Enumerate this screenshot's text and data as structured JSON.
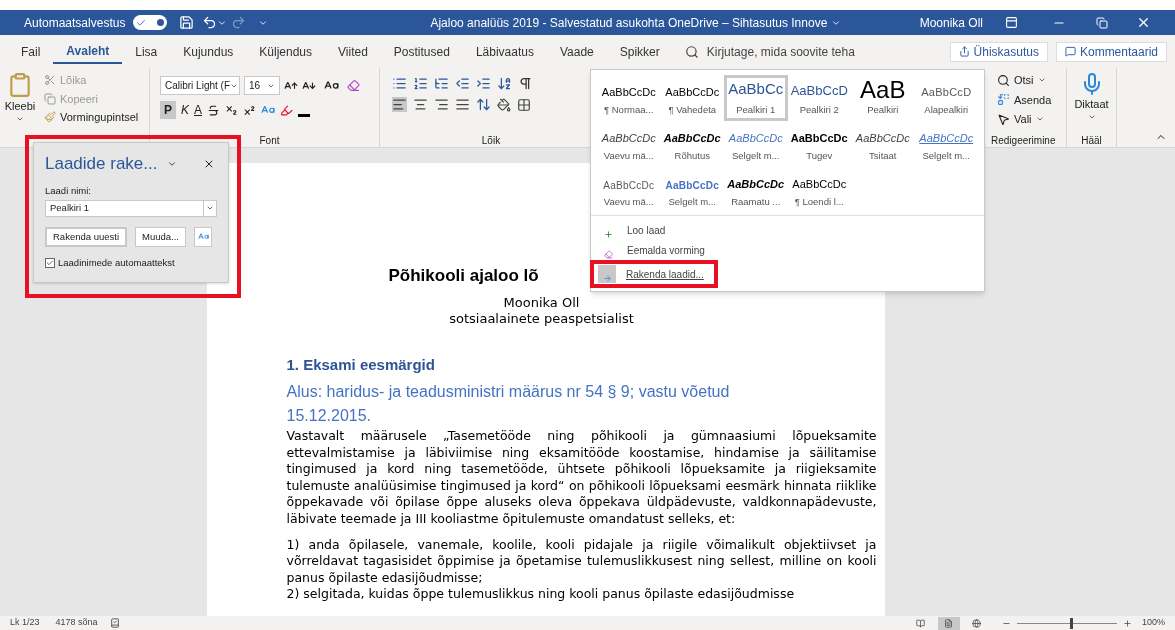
{
  "title_bar": {
    "autosave_label": "Automaatsalvestus",
    "autosave_on": true,
    "title": "Ajaloo analüüs 2019  -  Salvestatud asukohta OneDrive – Sihtasutus Innove",
    "user": "Moonika Oll"
  },
  "tabs": [
    {
      "label": "Fail",
      "selected": false
    },
    {
      "label": "Avaleht",
      "selected": true
    },
    {
      "label": "Lisa",
      "selected": false
    },
    {
      "label": "Kujundus",
      "selected": false
    },
    {
      "label": "Küljendus",
      "selected": false
    },
    {
      "label": "Viited",
      "selected": false
    },
    {
      "label": "Postitused",
      "selected": false
    },
    {
      "label": "Läbivaatus",
      "selected": false
    },
    {
      "label": "Vaade",
      "selected": false
    },
    {
      "label": "Spikker",
      "selected": false
    }
  ],
  "search": {
    "placeholder": "Kirjutage, mida soovite teha"
  },
  "share_button": "Ühiskasutus",
  "comments_button": "Kommentaarid",
  "clipboard": {
    "paste": "Kleebi",
    "cut": "Lõika",
    "copy": "Kopeeri",
    "format_painter": "Vormingupintsel"
  },
  "font": {
    "font_name": "Calibri Light (F",
    "size": "16",
    "bold": "P",
    "italic": "K",
    "underline": "A",
    "group_label": "Font"
  },
  "paragraph": {
    "group_label": "Lõik"
  },
  "editing": {
    "find": "Otsi",
    "replace": "Asenda",
    "select": "Vali",
    "group_label": "Redigeerimine"
  },
  "voice": {
    "dictate": "Diktaat",
    "group_label": "Hääl"
  },
  "styles_gallery": {
    "styles": [
      {
        "preview": "AaBbCcDc",
        "label": "¶ Normaa...",
        "kind": "normal",
        "selected": false
      },
      {
        "preview": "AaBbCcDc",
        "label": "¶ Vahedeta",
        "kind": "normal",
        "selected": false
      },
      {
        "preview": "AaBbCc",
        "label": "Pealkiri 1",
        "kind": "heading1",
        "selected": true
      },
      {
        "preview": "AaBbCcD",
        "label": "Pealkiri 2",
        "kind": "heading2",
        "selected": false
      },
      {
        "preview": "AaB",
        "label": "Pealkiri",
        "kind": "title",
        "selected": false
      },
      {
        "preview": "AaBbCcD",
        "label": "Alapealkiri",
        "kind": "subtitle",
        "selected": false
      },
      {
        "preview": "AaBbCcDc",
        "label": "Vaevu mä...",
        "kind": "subtle_emphasis",
        "selected": false
      },
      {
        "preview": "AaBbCcDc",
        "label": "Rõhutus",
        "kind": "emphasis",
        "selected": false
      },
      {
        "preview": "AaBbCcDc",
        "label": "Selgelt m...",
        "kind": "intense_emphasis",
        "selected": false
      },
      {
        "preview": "AaBbCcDc",
        "label": "Tugev",
        "kind": "strong",
        "selected": false
      },
      {
        "preview": "AaBbCcDc",
        "label": "Tsitaat",
        "kind": "quote",
        "selected": false
      },
      {
        "preview": "AaBbCcDc",
        "label": "Selgelt m...",
        "kind": "intense_quote",
        "selected": false
      },
      {
        "preview": "AaBbCcDc",
        "label": "Vaevu mä...",
        "kind": "subtle_reference",
        "selected": false
      },
      {
        "preview": "AaBbCcDc",
        "label": "Selgelt m...",
        "kind": "intense_reference",
        "selected": false
      },
      {
        "preview": "AaBbCcDc",
        "label": "Raamatu ...",
        "kind": "book_title",
        "selected": false
      },
      {
        "preview": "AaBbCcDc",
        "label": "¶ Loendi l...",
        "kind": "normal",
        "selected": false
      }
    ],
    "commands": [
      {
        "label": "Loo laad",
        "kind": "new",
        "highlighted": false
      },
      {
        "label": "Eemalda vorming",
        "kind": "clear",
        "highlighted": false
      },
      {
        "label": "Rakenda laadid...",
        "kind": "apply",
        "highlighted": true
      }
    ]
  },
  "styles_pane": {
    "title": "Laadide rake...",
    "field_label": "Laadi nimi:",
    "style_name": "Pealkiri 1",
    "reapply_button": "Rakenda uuesti",
    "modify_button": "Muuda...",
    "autocomplete_label": "Laadinimede automaattekst",
    "autocomplete_checked": true
  },
  "document": {
    "title": "Põhikooli ajaloo lõ",
    "author": "Moonika Oll",
    "position": "sotsiaalainete peaspetsialist",
    "heading_1": "1. Eksami eesmärgid",
    "heading_2": "Alus: haridus- ja teadusministri määrus nr 54 § 9; vastu võetud 15.12.2015.",
    "paragraphs": [
      "Vastavalt määrusele „Tasemetööde ning põhikooli ja gümnaasiumi lõpueksamite ettevalmistamise ja läbiviimise ning eksamitööde koostamise, hindamise ja säilitamise tingimused ja kord ning tasemetööde, ühtsete põhikooli lõpueksamite ja riigieksamite tulemuste analüüsimise tingimused ja kord“ on põhikooli lõpueksami eesmärk hinnata riiklike õppekavade või õpilase õppe aluseks oleva õppekava üldpädevuste, valdkonnapädevuste, läbivate teemade ja III kooliastme õpitulemuste omandatust selleks, et:"
    ],
    "list_items": [
      "1) anda õpilasele, vanemale, koolile, kooli pidajale ja riigile võimalikult objektiivset ja võrreldavat tagasisidet õppimise ja õpetamise tulemuslikkusest ning sellest, milline on kooli panus õpilaste edasijõudmisse;",
      "2) selgitada, kuidas õppe tulemuslikkus ning kooli panus õpilaste edasijõudmisse"
    ]
  },
  "status_bar": {
    "page": "Lk 1/23",
    "words": "4178 sõna",
    "views": [
      {
        "kind": "read",
        "selected": false
      },
      {
        "kind": "print",
        "selected": true
      },
      {
        "kind": "web",
        "selected": false
      }
    ],
    "zoom_slider": {
      "level": 0.55
    },
    "zoom": "100%"
  }
}
